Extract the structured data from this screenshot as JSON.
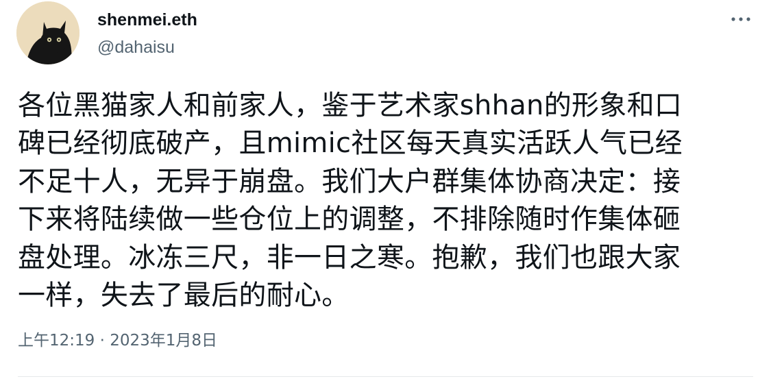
{
  "tweet": {
    "author": {
      "display_name": "shenmei.eth",
      "handle": "@dahaisu",
      "avatar_icon": "black-cat-avatar"
    },
    "more_icon": "more-options-icon",
    "body_lines": [
      "各位黑猫家人和前家人，鉴于艺术家shhan的形象和口",
      "碑已经彻底破产，且mimic社区每天真实活跃人气已经",
      "不足十人，无异于崩盘。我们大户群集体协商决定：接",
      "下来将陆续做一些仓位上的调整，不排除随时作集体砸",
      "盘处理。冰冻三尺，非一日之寒。抱歉，我们也跟大家",
      "一样，失去了最后的耐心。"
    ],
    "timestamp": "上午12:19 · 2023年1月8日"
  },
  "colors": {
    "primary_text": "#0f1419",
    "secondary_text": "#536471",
    "divider": "#e6e9ea"
  }
}
